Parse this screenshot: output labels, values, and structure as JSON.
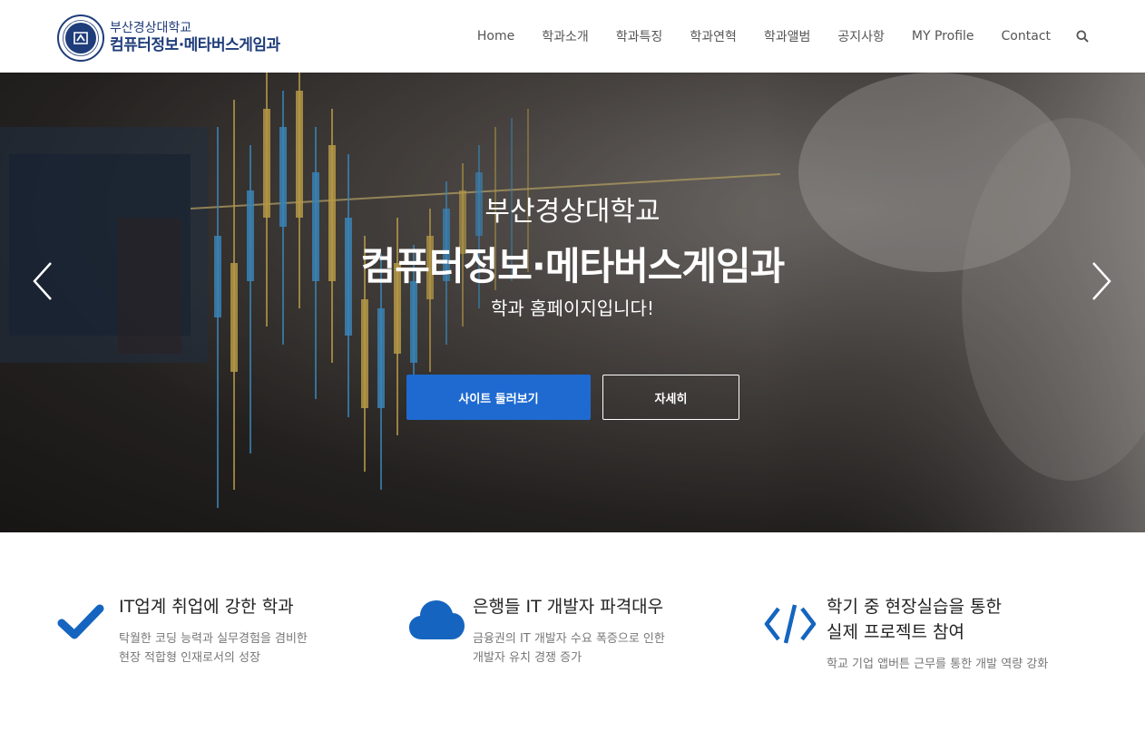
{
  "header": {
    "logo": {
      "line1": "부산경상대학교",
      "line2": "컴퓨터정보·메타버스게임과",
      "seal_text": "부산경상대학교 BUSAN KYUNGSANG COLLEGE"
    },
    "nav": [
      "Home",
      "학과소개",
      "학과특징",
      "학과연혁",
      "학과앨범",
      "공지사항",
      "MY Profile",
      "Contact"
    ],
    "search_icon": "search-icon"
  },
  "hero": {
    "subtitle": "부산경상대학교",
    "title": "컴퓨터정보·메타버스게임과",
    "tagline": "학과 홈페이지입니다!",
    "primary_button": "사이트 둘러보기",
    "secondary_button": "자세히",
    "prev_icon": "chevron-left-icon",
    "next_icon": "chevron-right-icon"
  },
  "features": [
    {
      "icon": "checkmark-icon",
      "title": "IT업계 취업에 강한 학과",
      "desc": [
        "탁월한 코딩 능력과 실무경험을 겸비한",
        "현장 적합형 인재로서의 성장"
      ]
    },
    {
      "icon": "cloud-icon",
      "title": "은행들 IT 개발자 파격대우",
      "desc": [
        "금융권의 IT 개발자 수요 폭증으로 인한",
        "개발자 유치 경쟁 증가"
      ]
    },
    {
      "icon": "code-icon",
      "title": "학기 중 현장실습을 통한",
      "title2": "실제 프로젝트 참여",
      "desc": [
        "학교 기업 앱버튼 근무를 통한 개발 역량 강화"
      ]
    }
  ],
  "colors": {
    "brand": "#1f3d7a",
    "accent": "#1e6ad0",
    "icon_blue": "#1565c0"
  }
}
